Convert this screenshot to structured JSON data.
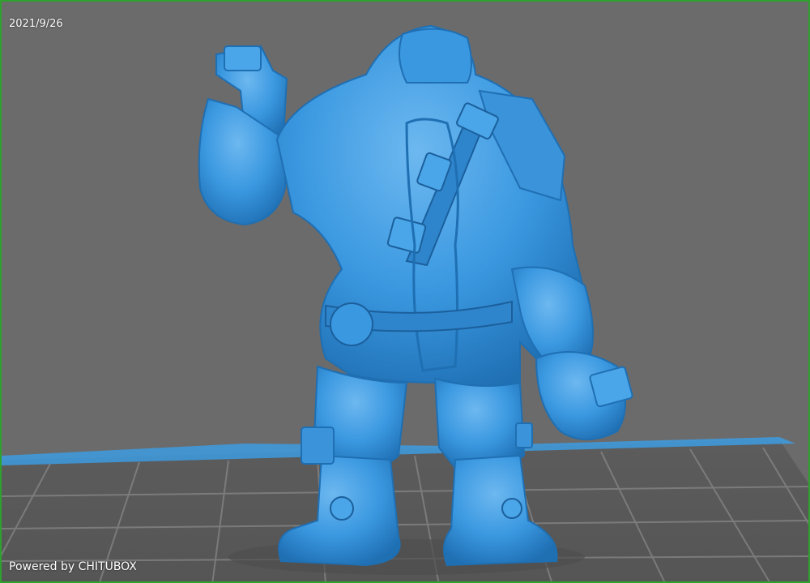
{
  "overlay": {
    "date": "2021/9/26",
    "powered_by": "Powered by CHITUBOX"
  },
  "scene": {
    "model_icon": "miniature-figure-icon",
    "build_plate_icon": "build-plate-grid-icon"
  },
  "colors": {
    "frame": "#2ea12e",
    "background": "#6b6b6b",
    "plate": "#5a5a5a",
    "plate_grid": "#8a8a8a",
    "plate_edge": "#3d9be0",
    "model": "#3a98e0",
    "model_dark": "#1f6fb3",
    "model_light": "#7cc4f5"
  }
}
